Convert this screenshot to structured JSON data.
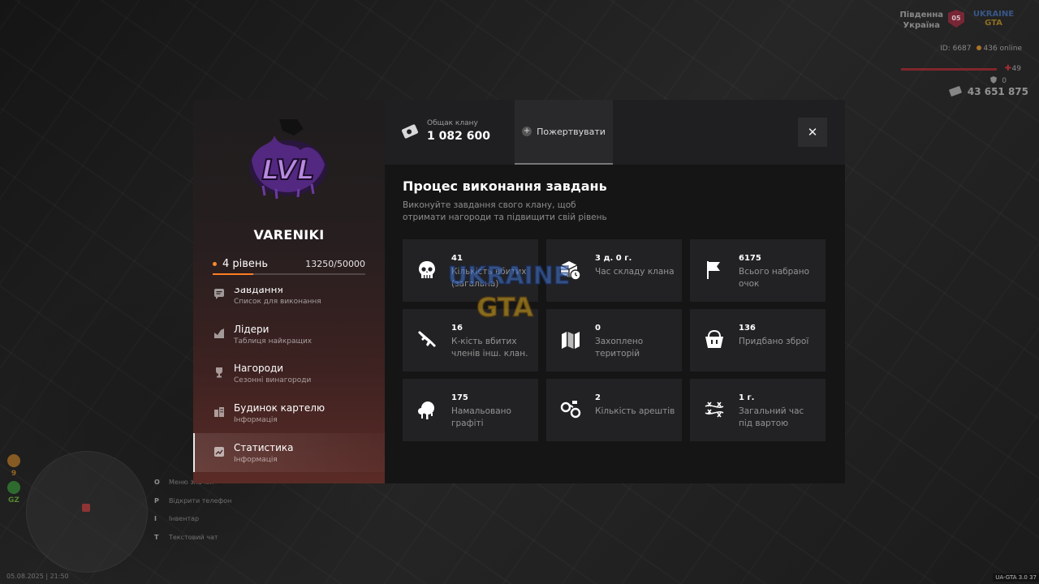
{
  "hud": {
    "region_line1": "Південна",
    "region_line2": "Україна",
    "server_badge": "05",
    "logo_top": "UKRAINE",
    "logo_bottom": "GTA",
    "player_id": "ID: 6687",
    "online": "436 online",
    "health": "49",
    "armor": "0",
    "money": "43 651 875",
    "side_value1": "9",
    "side_value2": "GZ",
    "hints": [
      {
        "key": "O",
        "label": "Меню значок"
      },
      {
        "key": "P",
        "label": "Відкрити телефон"
      },
      {
        "key": "I",
        "label": "Інвентар"
      },
      {
        "key": "T",
        "label": "Текстовий чат"
      }
    ],
    "datetime": "05.08.2025 | 21:50",
    "version": "UA-GTA 3.0  37"
  },
  "sidebar": {
    "clan_name": "VARENIKI",
    "level_label": "4 рівень",
    "xp_text": "13250/50000",
    "xp_progress": 0.265,
    "accent_color": "#ff7d22",
    "menu": [
      {
        "icon": "chat-icon",
        "title": "Завдання",
        "subtitle": "Список для виконання",
        "active": false
      },
      {
        "icon": "leaders-icon",
        "title": "Лідери",
        "subtitle": "Таблиця найкращих",
        "active": false
      },
      {
        "icon": "trophy-icon",
        "title": "Нагороди",
        "subtitle": "Сезонні винагороди",
        "active": false
      },
      {
        "icon": "building-icon",
        "title": "Будинок картелю",
        "subtitle": "Інформація",
        "active": false
      },
      {
        "icon": "stats-icon",
        "title": "Статистика",
        "subtitle": "Інформація",
        "active": true
      }
    ]
  },
  "topbar": {
    "treasury_label": "Общак клану",
    "treasury_value": "1 082 600",
    "donate_label": "Пожертвувати",
    "close_icon": "close-icon"
  },
  "main": {
    "title": "Процес виконання завдань",
    "description": "Виконуйте завдання свого клану, щоб отримати нагороди та підвищити свій рівень",
    "stats": [
      {
        "icon": "skull-icon",
        "value": "41",
        "label": "Кількість вбитих (загальна)"
      },
      {
        "icon": "box-clock-icon",
        "value": "3 д. 0 г.",
        "label": "Час складу клана"
      },
      {
        "icon": "flag-icon",
        "value": "6175",
        "label": "Всього набрано очок"
      },
      {
        "icon": "rifle-icon",
        "value": "16",
        "label": "К-кість вбитих членів інш. клан."
      },
      {
        "icon": "map-icon",
        "value": "0",
        "label": "Захоплено територій"
      },
      {
        "icon": "basket-icon",
        "value": "136",
        "label": "Придбано зброї"
      },
      {
        "icon": "spray-icon",
        "value": "175",
        "label": "Намальовано графіті"
      },
      {
        "icon": "handcuffs-icon",
        "value": "2",
        "label": "Кількість арештів"
      },
      {
        "icon": "barbed-wire-icon",
        "value": "1 г.",
        "label": "Загальний час під вартою"
      }
    ]
  },
  "watermark": {
    "top": "UKRAINE",
    "bottom": "GTA"
  }
}
